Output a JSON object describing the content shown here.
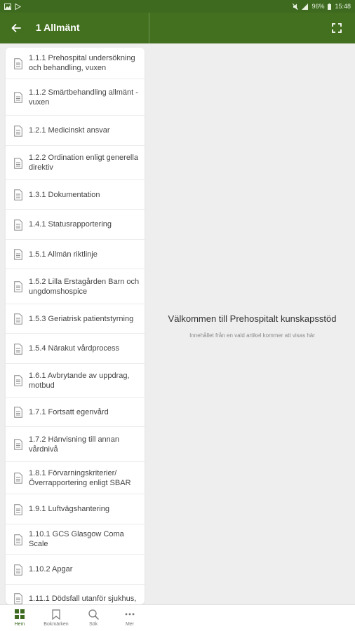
{
  "status_bar": {
    "battery": "96%",
    "time": "15:48"
  },
  "app_bar": {
    "title": "1 Allmänt"
  },
  "list": {
    "items": [
      {
        "label": "1.1.1 Prehospital undersökning och behandling, vuxen"
      },
      {
        "label": "1.1.2 Smärtbehandling allmänt - vuxen"
      },
      {
        "label": "1.2.1 Medicinskt ansvar"
      },
      {
        "label": "1.2.2 Ordination enligt generella direktiv"
      },
      {
        "label": "1.3.1 Dokumentation"
      },
      {
        "label": "1.4.1 Statusrapportering"
      },
      {
        "label": "1.5.1 Allmän riktlinje"
      },
      {
        "label": "1.5.2 Lilla Erstagården Barn och ungdomshospice"
      },
      {
        "label": "1.5.3 Geriatrisk patientstyrning"
      },
      {
        "label": "1.5.4 Närakut vårdprocess"
      },
      {
        "label": "1.6.1 Avbrytande av uppdrag, motbud"
      },
      {
        "label": "1.7.1 Fortsatt egenvård"
      },
      {
        "label": "1.7.2 Hänvisning till annan vårdnivå"
      },
      {
        "label": "1.8.1 Förvarningskriterier/ Överrapportering enligt SBAR"
      },
      {
        "label": "1.9.1 Luftvägshantering"
      },
      {
        "label": "1.10.1 GCS Glasgow Coma Scale"
      },
      {
        "label": "1.10.2 Apgar"
      },
      {
        "label": "1.11.1 Dödsfall utanför sjukhus,"
      }
    ]
  },
  "welcome": {
    "title": "Välkommen till Prehospitalt kunskapsstöd",
    "subtitle": "Innehållet från en vald artikel kommer att visas här"
  },
  "bottom_nav": {
    "items": [
      {
        "label": "Hem",
        "icon": "grid-icon",
        "active": true
      },
      {
        "label": "Bokmärken",
        "icon": "bookmark-icon",
        "active": false
      },
      {
        "label": "Sök",
        "icon": "search-icon",
        "active": false
      },
      {
        "label": "Mer",
        "icon": "more-icon",
        "active": false
      }
    ]
  },
  "colors": {
    "primary": "#43701f",
    "status_bar": "#3d6a1f",
    "background": "#eeeeee"
  }
}
